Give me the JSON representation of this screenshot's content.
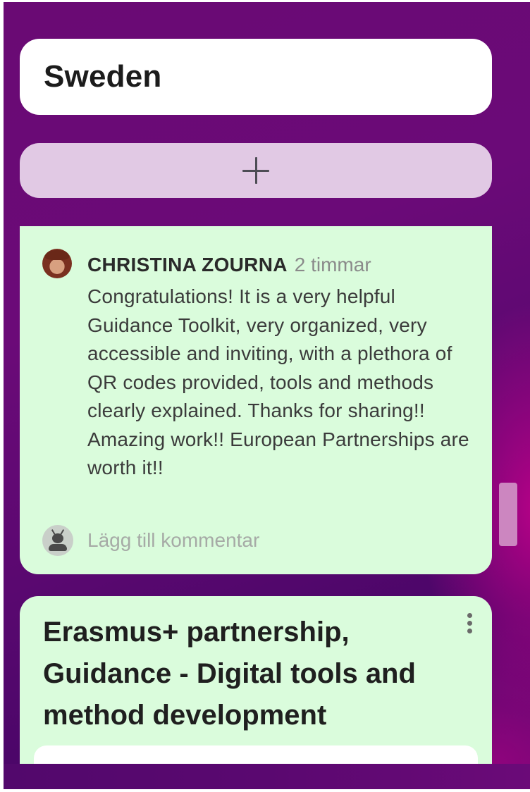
{
  "column": {
    "title": "Sweden"
  },
  "add_post": {
    "icon": "plus-icon"
  },
  "post": {
    "author": "CHRISTINA ZOURNA",
    "time": "2 timmar",
    "body": "Congratulations! It is a very helpful Guidance Toolkit, very organized, very accessible and inviting, with a plethora of QR codes provided, tools and methods clearly explained. Thanks for sharing!! Amazing work!! European Partnerships are worth it!!",
    "comment_placeholder": "Lägg till kommentar"
  },
  "next_post": {
    "title": "Erasmus+ partnership, Guidance - Digital tools and method development"
  },
  "colors": {
    "background_purple": "#6a0a74",
    "card_green": "#dafcdc",
    "add_bar": "#e1c9e4",
    "scrollbar": "#cc86c0"
  }
}
